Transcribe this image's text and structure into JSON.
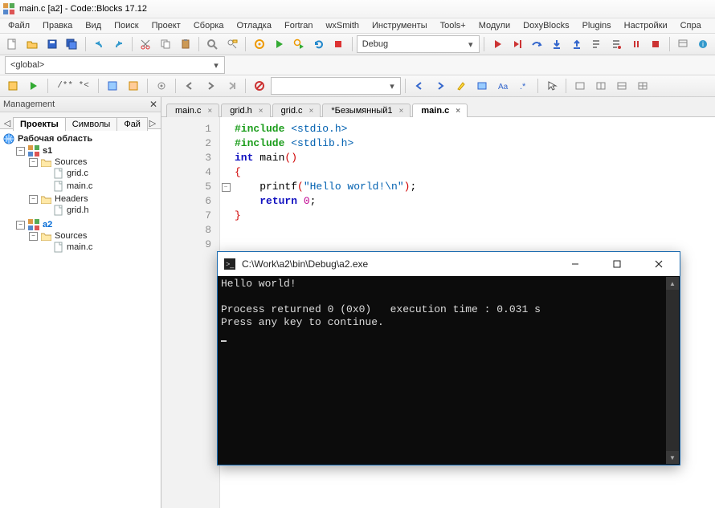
{
  "window": {
    "title": "main.c [a2] - Code::Blocks 17.12"
  },
  "menu": [
    "Файл",
    "Правка",
    "Вид",
    "Поиск",
    "Проект",
    "Сборка",
    "Отладка",
    "Fortran",
    "wxSmith",
    "Инструменты",
    "Tools+",
    "Модули",
    "DoxyBlocks",
    "Plugins",
    "Настройки",
    "Спра"
  ],
  "toolbar1": {
    "buildTarget": "Debug"
  },
  "scope": {
    "value": "<global>"
  },
  "toolbar3": {
    "comment": "/**  *<"
  },
  "management": {
    "title": "Management",
    "tabs": [
      "Проекты",
      "Символы",
      "Фай"
    ],
    "active": 0,
    "workspace": "Рабочая область",
    "projects": [
      {
        "name": "s1",
        "active": false,
        "folders": [
          {
            "name": "Sources",
            "open": true,
            "files": [
              "grid.c",
              "main.c"
            ]
          },
          {
            "name": "Headers",
            "open": true,
            "files": [
              "grid.h"
            ]
          }
        ]
      },
      {
        "name": "a2",
        "active": true,
        "folders": [
          {
            "name": "Sources",
            "open": true,
            "files": [
              "main.c"
            ]
          }
        ]
      }
    ]
  },
  "editorTabs": [
    {
      "label": "main.c",
      "active": false
    },
    {
      "label": "grid.h",
      "active": false
    },
    {
      "label": "grid.c",
      "active": false
    },
    {
      "label": "*Безымянный1",
      "active": false
    },
    {
      "label": "main.c",
      "active": true
    }
  ],
  "code": {
    "lines": [
      {
        "n": 1,
        "html": "<span class='kw'>#include</span> <span class='str'>&lt;stdio.h&gt;</span>"
      },
      {
        "n": 2,
        "html": "<span class='kw'>#include</span> <span class='str'>&lt;stdlib.h&gt;</span>"
      },
      {
        "n": 3,
        "html": ""
      },
      {
        "n": 4,
        "html": "<span class='kw2'>int</span> main<span class='brace'>()</span>"
      },
      {
        "n": 5,
        "html": "<span class='brace'>{</span>",
        "fold": true
      },
      {
        "n": 6,
        "html": "    printf<span class='brace'>(</span><span class='str'>\"Hello world!\\n\"</span><span class='brace'>)</span>;"
      },
      {
        "n": 7,
        "html": "    <span class='kw2'>return</span> <span class='num'>0</span>;"
      },
      {
        "n": 8,
        "html": "<span class='brace'>}</span>"
      },
      {
        "n": 9,
        "html": ""
      }
    ]
  },
  "console": {
    "title": "C:\\Work\\a2\\bin\\Debug\\a2.exe",
    "output": "Hello world!\n\nProcess returned 0 (0x0)   execution time : 0.031 s\nPress any key to continue.\n"
  }
}
